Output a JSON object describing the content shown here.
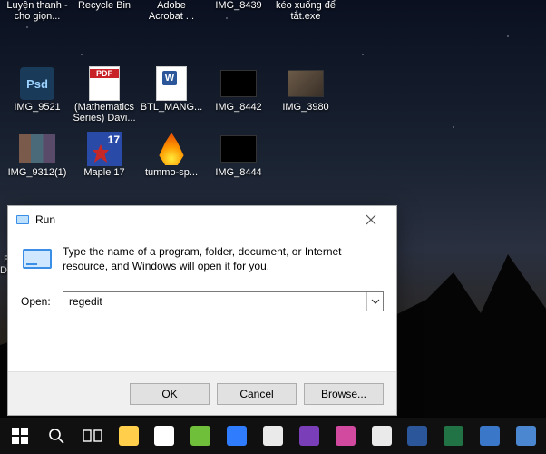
{
  "desktop": {
    "rows": [
      [
        {
          "label": "Luyện thanh - cho giọn..."
        },
        {
          "label": "Recycle Bin"
        },
        {
          "label": "Adobe Acrobat ..."
        },
        {
          "label": "IMG_8439"
        },
        {
          "label": "kéo xuống để tắt.exe"
        }
      ],
      [
        {
          "label": "IMG_9521",
          "icon": "psd",
          "badge": "Psd"
        },
        {
          "label": "(Mathematics Series) Davi...",
          "icon": "pdf"
        },
        {
          "label": "BTL_MANG...",
          "icon": "docx"
        },
        {
          "label": "IMG_8442",
          "icon": "thumb"
        },
        {
          "label": "IMG_3980",
          "icon": "thumb photo"
        }
      ],
      [
        {
          "label": "IMG_9312(1)",
          "icon": "people"
        },
        {
          "label": "Maple 17",
          "icon": "maple",
          "badge": "17"
        },
        {
          "label": "tummo-sp...",
          "icon": "fire"
        },
        {
          "label": "IMG_8444",
          "icon": "thumb"
        }
      ]
    ]
  },
  "behind_label_line1": "E",
  "behind_label_line2": "Da",
  "run": {
    "title": "Run",
    "message": "Type the name of a program, folder, document, or Internet resource, and Windows will open it for you.",
    "open_label": "Open:",
    "open_value": "regedit",
    "ok": "OK",
    "cancel": "Cancel",
    "browse": "Browse..."
  },
  "taskbar": {
    "items": [
      {
        "name": "start",
        "color": ""
      },
      {
        "name": "search-icon",
        "color": ""
      },
      {
        "name": "task-view-icon",
        "color": ""
      },
      {
        "name": "file-explorer-icon",
        "color": "#ffcf4b"
      },
      {
        "name": "store-icon",
        "color": "#ffffff"
      },
      {
        "name": "coccoc-icon",
        "color": "#6fbf3a"
      },
      {
        "name": "zalo-icon",
        "color": "#2f7cff"
      },
      {
        "name": "app-white-1",
        "color": "#eaeaea"
      },
      {
        "name": "visual-studio-icon",
        "color": "#7a3fb8"
      },
      {
        "name": "picsart-icon",
        "color": "#d24aa0"
      },
      {
        "name": "app-white-2",
        "color": "#eaeaea"
      },
      {
        "name": "word-icon",
        "color": "#2b579a"
      },
      {
        "name": "excel-icon",
        "color": "#217346"
      },
      {
        "name": "app-blue-1",
        "color": "#3a77c9"
      },
      {
        "name": "app-blue-2",
        "color": "#4a87d0"
      }
    ]
  }
}
